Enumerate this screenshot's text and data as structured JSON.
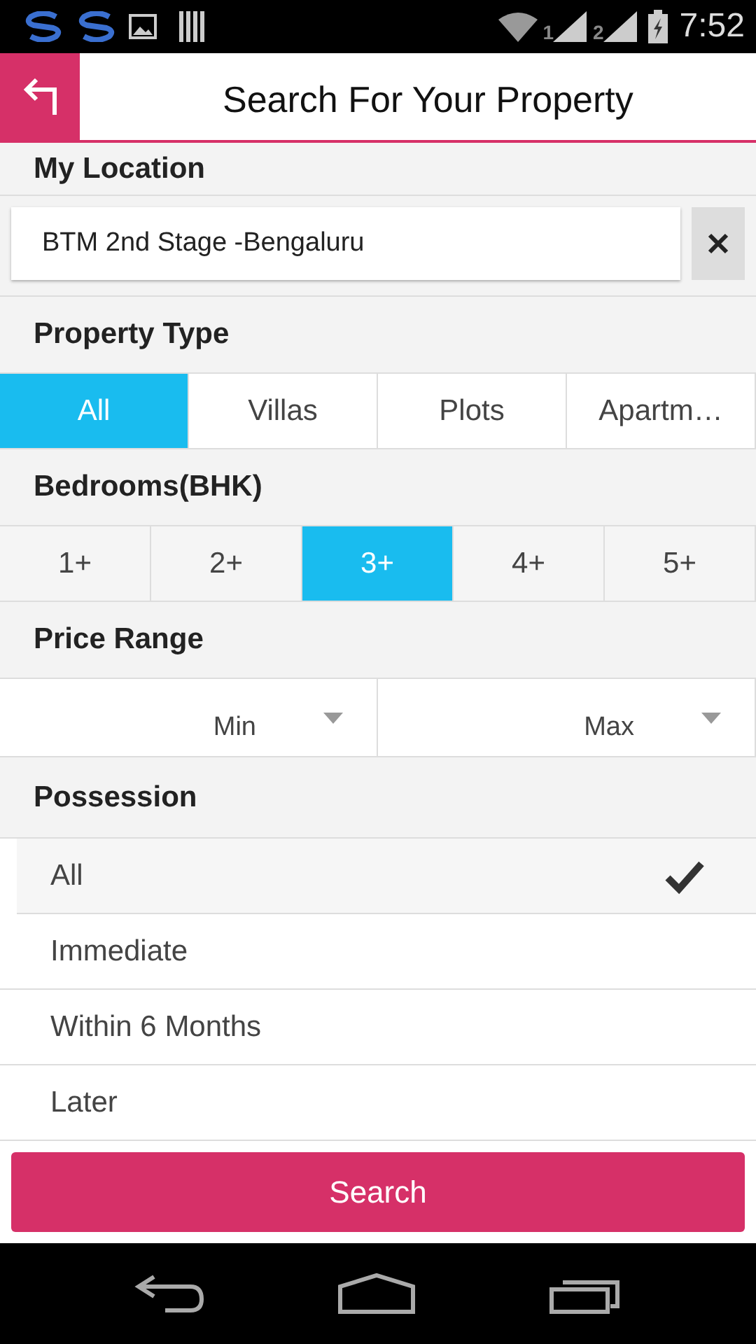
{
  "status_bar": {
    "sim_1": "1",
    "sim_2": "2",
    "time": "7:52"
  },
  "header": {
    "title": "Search For Your Property"
  },
  "location": {
    "heading": "My Location",
    "value": "BTM 2nd Stage -Bengaluru"
  },
  "property_type": {
    "heading": "Property Type",
    "options": [
      {
        "label": "All",
        "selected": true
      },
      {
        "label": "Villas",
        "selected": false
      },
      {
        "label": "Plots",
        "selected": false
      },
      {
        "label": "Apartm…",
        "selected": false
      }
    ]
  },
  "bedrooms": {
    "heading": "Bedrooms(BHK)",
    "options": [
      {
        "label": "1+",
        "selected": false
      },
      {
        "label": "2+",
        "selected": false
      },
      {
        "label": "3+",
        "selected": true
      },
      {
        "label": "4+",
        "selected": false
      },
      {
        "label": "5+",
        "selected": false
      }
    ]
  },
  "price_range": {
    "heading": "Price Range",
    "dropdowns": [
      {
        "value": "Min"
      },
      {
        "value": "Max"
      }
    ]
  },
  "possession": {
    "heading": "Possession",
    "options": [
      {
        "label": "All",
        "selected": true
      },
      {
        "label": "Immediate",
        "selected": false
      },
      {
        "label": "Within 6 Months",
        "selected": false
      },
      {
        "label": "Later",
        "selected": false
      }
    ]
  },
  "search_button": {
    "label": "Search"
  }
}
